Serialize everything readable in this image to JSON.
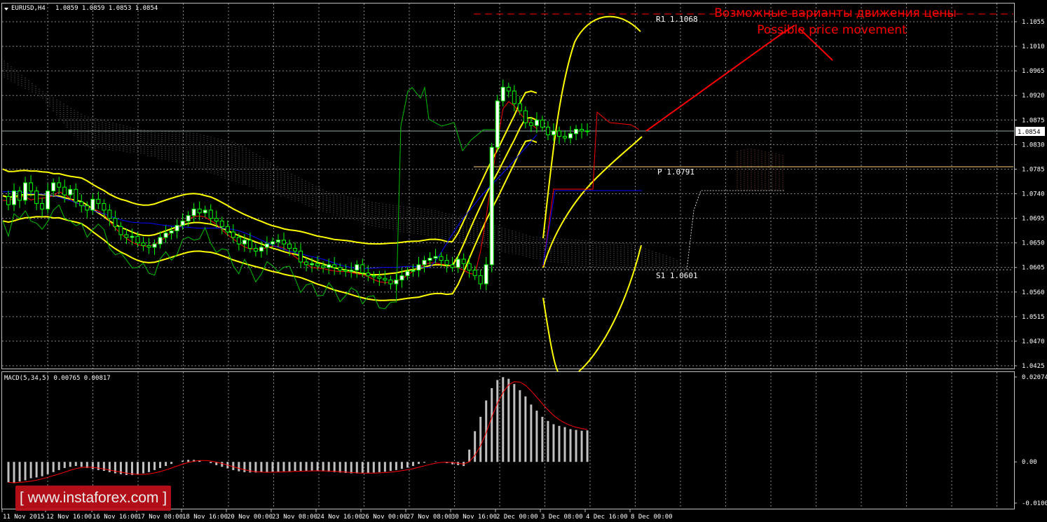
{
  "header": {
    "symbol": "EURUSD,H4",
    "ohlc": "1.0859 1.0859 1.0853 1.0854"
  },
  "price_axis": {
    "ticks": [
      "1.1055",
      "1.1010",
      "1.0965",
      "1.0920",
      "1.0875",
      "1.0830",
      "1.0785",
      "1.0740",
      "1.0695",
      "1.0650",
      "1.0605",
      "1.0560",
      "1.0515",
      "1.0470",
      "1.0425"
    ],
    "current_label": "1.0854"
  },
  "macd": {
    "header": "MACD(5,34,5) 0.00765 0.00817",
    "ticks": [
      "0.02074",
      "0.00",
      "-0.01006"
    ]
  },
  "time_axis": {
    "labels": [
      "11 Nov 2015",
      "12 Nov 16:00",
      "16 Nov 16:00",
      "17 Nov 08:00",
      "18 Nov 16:00",
      "20 Nov 00:00",
      "23 Nov 08:00",
      "24 Nov 16:00",
      "26 Nov 00:00",
      "27 Nov 08:00",
      "30 Nov 16:00",
      "2 Dec 00:00",
      "3 Dec 08:00",
      "4 Dec 16:00",
      "8 Dec 00:00"
    ]
  },
  "levels": {
    "r1": "R1 1.1068",
    "p": "P 1.0791",
    "s1": "S1 1.0601"
  },
  "annotation": {
    "ru": "Возможные варианты движения цены",
    "en": "Possible price movement"
  },
  "watermark": "[ www.instaforex.com ]",
  "colors": {
    "background": "#000000",
    "grid": "#8a8a8a",
    "bull_candle": "#ffffff",
    "bear_candle": "#000000",
    "candle_wick": "#00ff00",
    "bands": "#ffff00",
    "tenkan": "#ff0000",
    "kijun": "#0000ff",
    "chikou": "#00c000",
    "cloud": "#ffffff",
    "cloud_alt": "#e08060",
    "annotation": "#ff0000",
    "macd_hist": "#c0c0c0",
    "macd_signal": "#ff0000",
    "watermark_bg": "#c0101a"
  },
  "chart_data": {
    "type": "candlestick",
    "title": "EURUSD,H4",
    "ylim": [
      1.0425,
      1.1055
    ],
    "levels": {
      "R1": 1.1068,
      "P": 1.0791,
      "S1": 1.0601
    },
    "current_price": 1.0854,
    "close_series": [
      1.0735,
      1.072,
      1.0745,
      1.0728,
      1.076,
      1.0745,
      1.0722,
      1.0712,
      1.0745,
      1.076,
      1.0752,
      1.0738,
      1.0748,
      1.0725,
      1.0718,
      1.071,
      1.073,
      1.0722,
      1.071,
      1.0695,
      1.068,
      1.0665,
      1.066,
      1.0662,
      1.065,
      1.0645,
      1.0642,
      1.0648,
      1.066,
      1.0668,
      1.0672,
      1.0682,
      1.069,
      1.07,
      1.0712,
      1.0705,
      1.071,
      1.0695,
      1.069,
      1.068,
      1.067,
      1.066,
      1.0648,
      1.0655,
      1.064,
      1.0635,
      1.0642,
      1.0648,
      1.0652,
      1.0655,
      1.0648,
      1.064,
      1.0635,
      1.0615,
      1.061,
      1.0612,
      1.0608,
      1.0605,
      1.061,
      1.0605,
      1.06,
      1.0598,
      1.06,
      1.061,
      1.0595,
      1.059,
      1.0588,
      1.0585,
      1.0582,
      1.0575,
      1.0582,
      1.059,
      1.0598,
      1.06,
      1.061,
      1.0618,
      1.0622,
      1.0625,
      1.0618,
      1.061,
      1.0605,
      1.062,
      1.0612,
      1.06,
      1.059,
      1.0575,
      1.061,
      1.0825,
      1.091,
      1.0935,
      1.0928,
      1.0905,
      1.0892,
      1.087,
      1.0865,
      1.0875,
      1.0862,
      1.0848,
      1.0855,
      1.0845,
      1.0842,
      1.085,
      1.0858,
      1.0855,
      1.0854
    ],
    "macd_histogram": [
      -0.005,
      -0.0052,
      -0.0048,
      -0.0045,
      -0.004,
      -0.0038,
      -0.0035,
      -0.003,
      -0.0025,
      -0.002,
      -0.0015,
      -0.0012,
      -0.001,
      -0.0012,
      -0.0015,
      -0.0018,
      -0.002,
      -0.0022,
      -0.0025,
      -0.0028,
      -0.003,
      -0.0032,
      -0.0032,
      -0.003,
      -0.0028,
      -0.0025,
      -0.002,
      -0.0015,
      -0.001,
      -0.0005,
      0.0,
      0.0003,
      0.0005,
      0.0005,
      0.0003,
      0.0,
      -0.0003,
      -0.0008,
      -0.0012,
      -0.0016,
      -0.002,
      -0.0023,
      -0.0025,
      -0.0026,
      -0.0026,
      -0.0025,
      -0.0025,
      -0.0024,
      -0.0024,
      -0.0023,
      -0.0023,
      -0.0022,
      -0.0022,
      -0.0022,
      -0.0021,
      -0.0022,
      -0.0023,
      -0.0024,
      -0.0025,
      -0.0026,
      -0.0027,
      -0.0028,
      -0.0028,
      -0.0028,
      -0.0027,
      -0.0026,
      -0.0025,
      -0.0024,
      -0.0022,
      -0.002,
      -0.0017,
      -0.0014,
      -0.001,
      -0.0005,
      -0.0002,
      0.0,
      0.0001,
      0.0,
      -0.0003,
      -0.0006,
      -0.0008,
      -0.001,
      0.003,
      0.0075,
      0.011,
      0.015,
      0.018,
      0.02,
      0.0207,
      0.0203,
      0.019,
      0.0175,
      0.016,
      0.014,
      0.0125,
      0.011,
      0.01,
      0.0092,
      0.0088,
      0.0085,
      0.008,
      0.0078,
      0.0076,
      0.0077
    ],
    "macd_ylim": [
      -0.01006,
      0.02074
    ]
  }
}
